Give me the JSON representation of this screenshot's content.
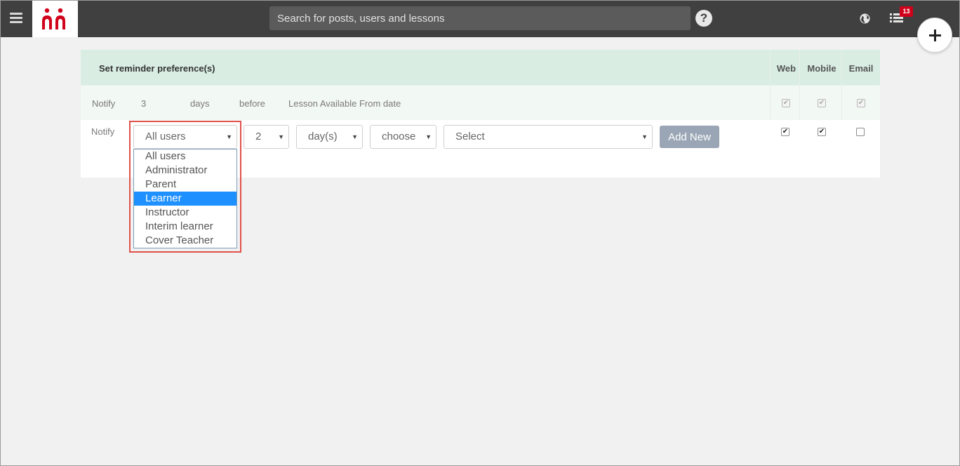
{
  "topbar": {
    "search_placeholder": "Search for posts, users and lessons",
    "help_symbol": "?",
    "notification_count": "13"
  },
  "table": {
    "header": {
      "title": "Set reminder preference(s)",
      "columns": [
        "Web",
        "Mobile",
        "Email"
      ]
    },
    "existing_row": {
      "notify_label": "Notify",
      "amount": "3",
      "unit": "days",
      "relation": "before",
      "event": "Lesson Available From date",
      "web": true,
      "mobile": true,
      "email": true
    },
    "new_row": {
      "notify_label": "Notify",
      "audience_value": "All users",
      "amount_value": "2",
      "unit_value": "day(s)",
      "relation_value": "choose",
      "event_value": "Select",
      "add_button": "Add New",
      "web": true,
      "mobile": true,
      "email": false
    }
  },
  "dropdown": {
    "options": [
      "All users",
      "Administrator",
      "Parent",
      "Learner",
      "Instructor",
      "Interim learner",
      "Cover Teacher"
    ],
    "highlighted": "Learner"
  },
  "colors": {
    "topbar": "#404040",
    "header_row": "#d9ede2",
    "highlight_border": "#e0514b",
    "selected_option": "#1e90ff",
    "logo_red": "#d0021b"
  }
}
